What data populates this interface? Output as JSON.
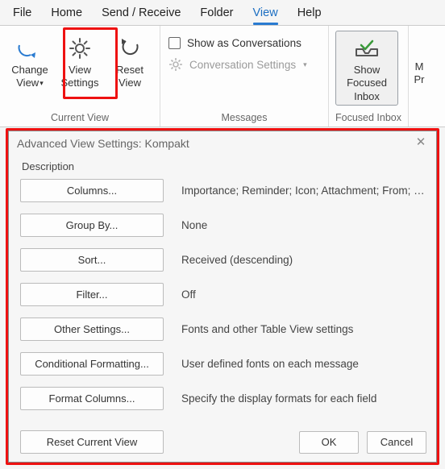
{
  "menu": {
    "file": "File",
    "home": "Home",
    "send_receive": "Send / Receive",
    "folder": "Folder",
    "view": "View",
    "help": "Help"
  },
  "ribbon": {
    "current_view": {
      "label": "Current View",
      "change_view": "Change View",
      "view_settings": "View Settings",
      "reset_view": "Reset View"
    },
    "messages": {
      "label": "Messages",
      "show_conv": "Show as Conversations",
      "conv_settings": "Conversation Settings"
    },
    "focused": {
      "label": "Focused Inbox",
      "show_focused": "Show Focused Inbox"
    },
    "trail": {
      "m": "M",
      "p": "Pr"
    }
  },
  "dialog": {
    "title": "Advanced View Settings: Kompakt",
    "description_label": "Description",
    "rows": [
      {
        "btn": "Columns...",
        "desc": "Importance; Reminder; Icon; Attachment; From; Subject; Re..."
      },
      {
        "btn": "Group By...",
        "desc": "None"
      },
      {
        "btn": "Sort...",
        "desc": "Received (descending)"
      },
      {
        "btn": "Filter...",
        "desc": "Off"
      },
      {
        "btn": "Other Settings...",
        "desc": "Fonts and other Table View settings"
      },
      {
        "btn": "Conditional Formatting...",
        "desc": "User defined fonts on each message"
      },
      {
        "btn": "Format Columns...",
        "desc": "Specify the display formats for each field"
      }
    ],
    "reset": "Reset Current View",
    "ok": "OK",
    "cancel": "Cancel"
  }
}
